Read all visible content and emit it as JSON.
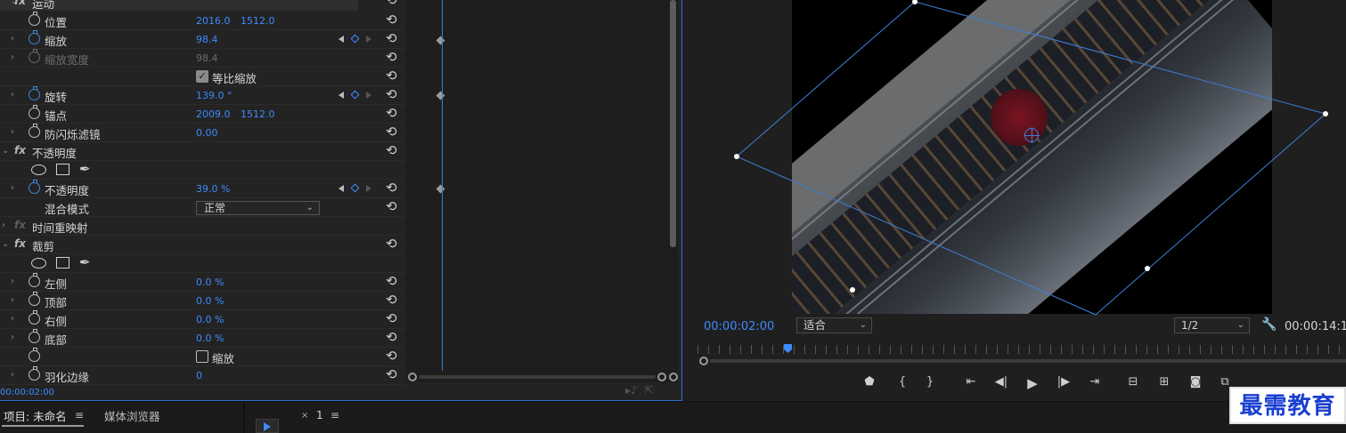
{
  "effects": {
    "motion": {
      "label": "运动"
    },
    "position": {
      "label": "位置",
      "x": "2016.0",
      "y": "1512.0"
    },
    "scale": {
      "label": "缩放",
      "value": "98.4"
    },
    "scale_width": {
      "label": "缩放宽度",
      "value": "98.4"
    },
    "uniform_scale": {
      "label": "等比缩放",
      "checked": true
    },
    "rotation": {
      "label": "旋转",
      "value": "139.0 °"
    },
    "anchor": {
      "label": "锚点",
      "x": "2009.0",
      "y": "1512.0"
    },
    "anti_flicker": {
      "label": "防闪烁滤镜",
      "value": "0.00"
    },
    "opacity_group": {
      "label": "不透明度"
    },
    "opacity": {
      "label": "不透明度",
      "value": "39.0 %"
    },
    "blend_mode": {
      "label": "混合模式",
      "value": "正常"
    },
    "time_remap": {
      "label": "时间重映射"
    },
    "crop": {
      "label": "裁剪"
    },
    "crop_left": {
      "label": "左侧",
      "value": "0.0 %"
    },
    "crop_top": {
      "label": "顶部",
      "value": "0.0 %"
    },
    "crop_right": {
      "label": "右侧",
      "value": "0.0 %"
    },
    "crop_bottom": {
      "label": "底部",
      "value": "0.0 %"
    },
    "crop_zoom": {
      "label": "缩放",
      "checked": false
    },
    "feather": {
      "label": "羽化边缘",
      "value": "0"
    },
    "fx_label": "fx",
    "current_time": "00:00:02:00"
  },
  "monitor": {
    "timecode": "00:00:02:00",
    "fit": "适合",
    "resolution": "1/2",
    "duration": "00:00:14:1"
  },
  "bottom": {
    "project_tab": "项目: 未命名",
    "media_browser_tab": "媒体浏览器",
    "sequence_close": "×",
    "sequence_name": "1",
    "menu_glyph": "≡"
  },
  "watermark": "最需教育",
  "colors": {
    "accent": "#3d8bff",
    "panel": "#232323",
    "frame": "#000000"
  }
}
